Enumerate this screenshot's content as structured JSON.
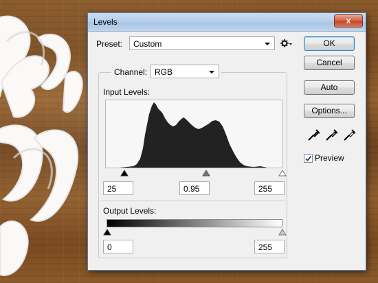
{
  "window": {
    "title": "Levels",
    "close_glyph": "x"
  },
  "preset": {
    "label": "Preset:",
    "value": "Custom"
  },
  "channel": {
    "label": "Channel:",
    "value": "RGB"
  },
  "input_levels": {
    "label": "Input Levels:",
    "black": "25",
    "gamma": "0.95",
    "white": "255"
  },
  "output_levels": {
    "label": "Output Levels:",
    "black": "0",
    "white": "255"
  },
  "buttons": {
    "ok": "OK",
    "cancel": "Cancel",
    "auto": "Auto",
    "options": "Options..."
  },
  "preview": {
    "label": "Preview",
    "checked": true
  },
  "icons": [
    "close-icon",
    "preset-options-gear-icon",
    "chevron-down-icon",
    "black-point-eyedropper-icon",
    "gray-point-eyedropper-icon",
    "white-point-eyedropper-icon",
    "checkmark-icon"
  ],
  "colors": {
    "titlebar": "#b9d0ea",
    "close": "#c34a2b",
    "dialog": "#f0f0f0",
    "histogram": "#222222"
  }
}
